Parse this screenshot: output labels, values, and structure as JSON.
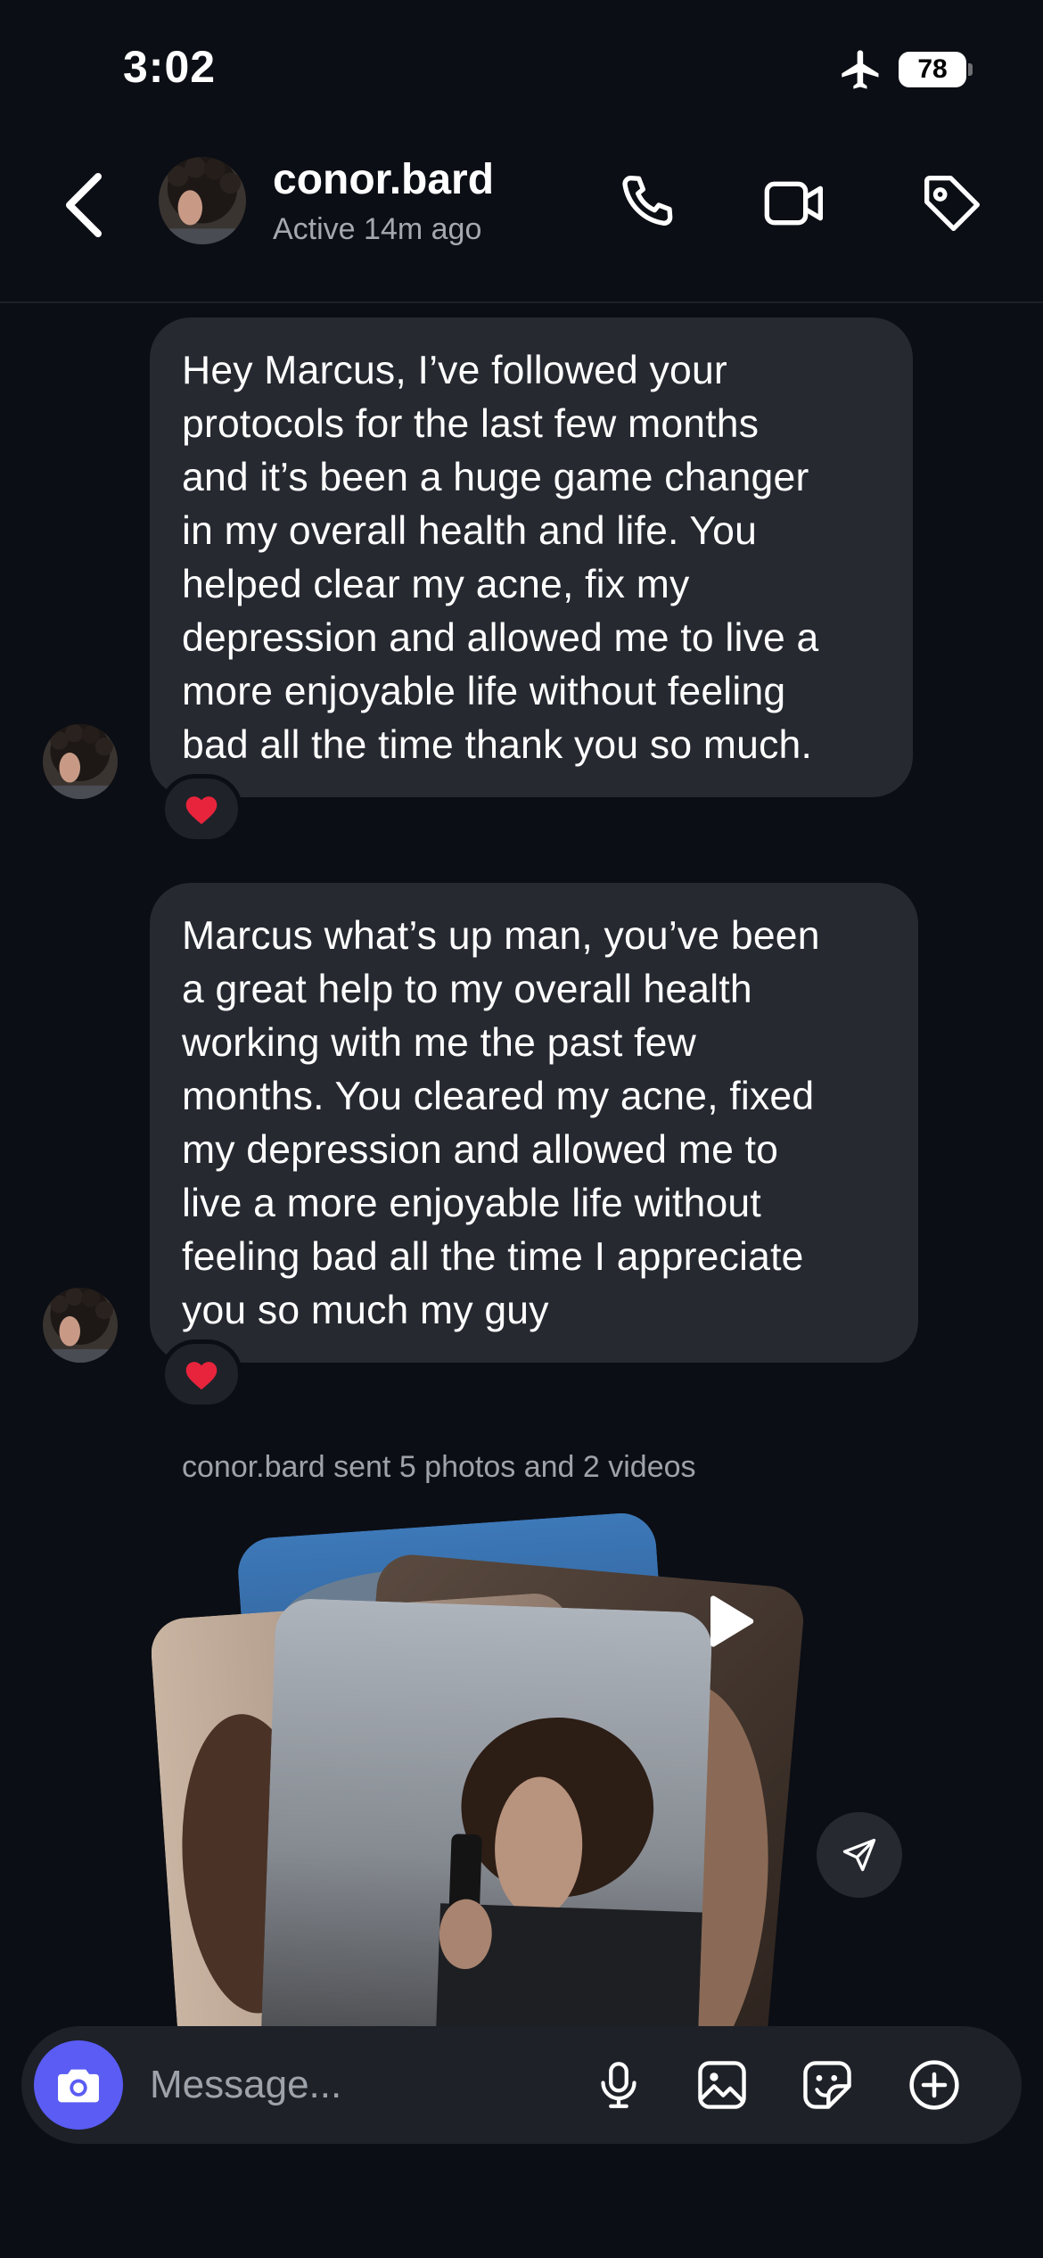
{
  "status_bar": {
    "time": "3:02",
    "battery": "78",
    "airplane_icon": "airplane-icon"
  },
  "header": {
    "username": "conor.bard",
    "status": "Active 14m ago",
    "icons": [
      "back-icon",
      "phone-icon",
      "video-camera-icon",
      "tag-icon"
    ]
  },
  "messages": [
    {
      "sender": "conor.bard",
      "lines": [
        "Hey Marcus, I’ve followed your",
        "protocols for the last few months",
        "and it’s been a huge game changer",
        "in my overall health and life. You",
        "helped clear my acne, fix my",
        "depression and allowed me to live a",
        "more enjoyable life without feeling",
        "bad all the time thank you so much."
      ],
      "reaction": "heart"
    },
    {
      "sender": "conor.bard",
      "lines": [
        "Marcus what’s up man, you’ve been",
        "a great help to my overall health",
        "working with me the past few",
        "months. You cleared my acne, fixed",
        "my depression and allowed me to",
        "live a more enjoyable life without",
        "feeling bad all the time I appreciate",
        "you so much my guy"
      ],
      "reaction": "heart"
    }
  ],
  "media_caption": "conor.bard sent 5 photos and 2 videos",
  "composer": {
    "placeholder": "Message...",
    "icons": [
      "camera-icon",
      "microphone-icon",
      "image-icon",
      "sticker-icon",
      "plus-circle-icon"
    ],
    "accent_color": "#5a5cf4"
  },
  "colors": {
    "background": "#0b0e14",
    "bubble": "#262930",
    "reaction_heart": "#e8243c"
  }
}
